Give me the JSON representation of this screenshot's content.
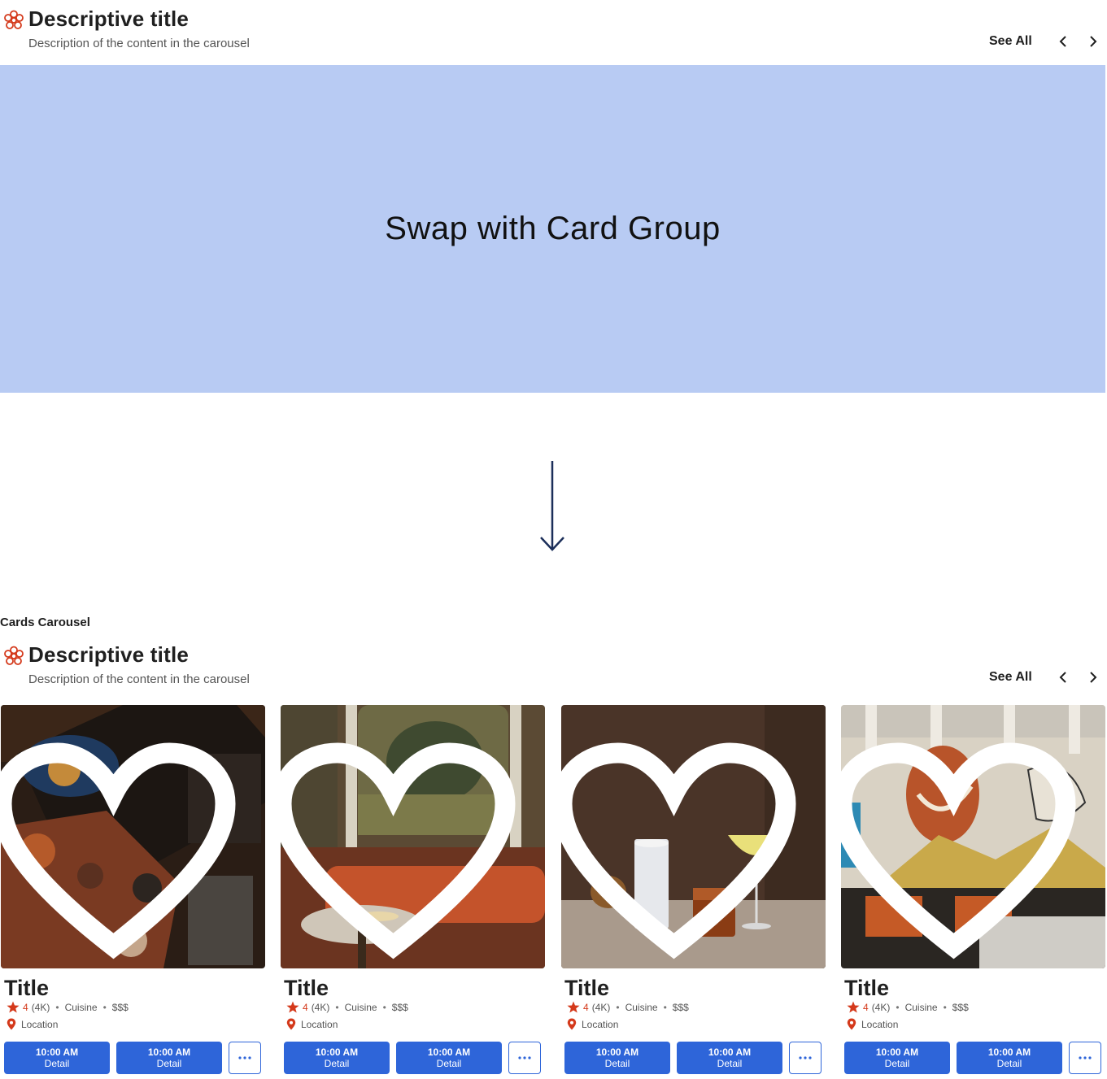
{
  "header_top": {
    "title": "Descriptive title",
    "description": "Description of the content in the carousel",
    "see_all": "See All"
  },
  "placeholder": {
    "text": "Swap with Card Group"
  },
  "section_label": "Cards Carousel",
  "header_bottom": {
    "title": "Descriptive title",
    "description": "Description of the content in the carousel",
    "see_all": "See All"
  },
  "cards": [
    {
      "title": "Title",
      "rating": "4",
      "reviews": "(4K)",
      "cuisine": "Cuisine",
      "price": "$$$",
      "location": "Location",
      "slots": [
        {
          "time": "10:00 AM",
          "detail": "Detail"
        },
        {
          "time": "10:00 AM",
          "detail": "Detail"
        }
      ],
      "more": "···"
    },
    {
      "title": "Title",
      "rating": "4",
      "reviews": "(4K)",
      "cuisine": "Cuisine",
      "price": "$$$",
      "location": "Location",
      "slots": [
        {
          "time": "10:00 AM",
          "detail": "Detail"
        },
        {
          "time": "10:00 AM",
          "detail": "Detail"
        }
      ],
      "more": "···"
    },
    {
      "title": "Title",
      "rating": "4",
      "reviews": "(4K)",
      "cuisine": "Cuisine",
      "price": "$$$",
      "location": "Location",
      "slots": [
        {
          "time": "10:00 AM",
          "detail": "Detail"
        },
        {
          "time": "10:00 AM",
          "detail": "Detail"
        }
      ],
      "more": "···"
    },
    {
      "title": "Title",
      "rating": "4",
      "reviews": "(4K)",
      "cuisine": "Cuisine",
      "price": "$$$",
      "location": "Location",
      "slots": [
        {
          "time": "10:00 AM",
          "detail": "Detail"
        },
        {
          "time": "10:00 AM",
          "detail": "Detail"
        }
      ],
      "more": "···"
    }
  ],
  "colors": {
    "accent": "#2e65d9",
    "brand_red": "#d4391b",
    "placeholder_bg": "#b8cbf3",
    "arrow": "#1c2f5a"
  },
  "icons": {
    "brand": "flower-icon",
    "prev": "chevron-left-icon",
    "next": "chevron-right-icon",
    "favorite": "heart-icon",
    "rating": "star-icon",
    "location": "map-pin-icon",
    "flow": "arrow-down-icon"
  }
}
